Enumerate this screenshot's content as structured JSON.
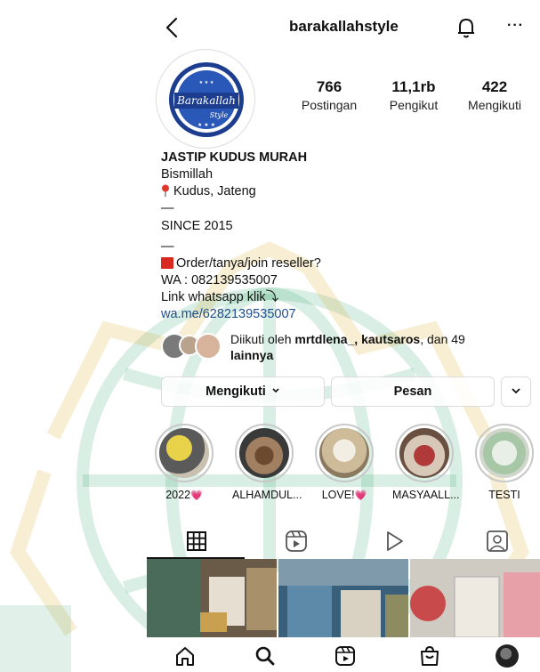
{
  "header": {
    "username": "barakallahstyle",
    "more": "···"
  },
  "profile": {
    "avatar_text": "Barakallah Style",
    "stats": [
      {
        "value": "766",
        "label": "Postingan"
      },
      {
        "value": "11,1rb",
        "label": "Pengikut"
      },
      {
        "value": "422",
        "label": "Mengikuti"
      }
    ]
  },
  "bio": {
    "name": "JASTIP KUDUS MURAH",
    "line1": "Bismillah",
    "location": "Kudus, Jateng",
    "dash1": "—",
    "since": "SINCE 2015",
    "dash2": "—",
    "order": "Order/tanya/join reseller?",
    "wa": "WA : 082139535007",
    "link_label": "Link whatsapp klik⤵",
    "link": "wa.me/6282139535007"
  },
  "followed_by": {
    "prefix": "Diikuti oleh ",
    "names": "mrtdlena_, kautsaros",
    "suffix": ", dan 49",
    "more": "lainnya"
  },
  "actions": {
    "follow": "Mengikuti",
    "message": "Pesan"
  },
  "highlights": [
    {
      "label": "2022",
      "heart": "💗",
      "color": "#c9a740"
    },
    {
      "label": "ALHAMDUL...",
      "heart": "",
      "color": "#8a6a4a"
    },
    {
      "label": "LOVE!",
      "heart": "💗",
      "color": "#d9c8b0"
    },
    {
      "label": "MASYAALL...",
      "heart": "",
      "color": "#a84a4a"
    },
    {
      "label": "TESTI",
      "heart": "",
      "color": "#9fbfa0"
    }
  ],
  "icons": {
    "back": "back-arrow-icon",
    "bell": "bell-icon",
    "grid": "grid-icon",
    "reels": "reels-icon",
    "video": "play-icon",
    "tagged": "tagged-icon",
    "home": "home-icon",
    "search": "search-icon",
    "reels_nav": "reels-icon",
    "shop": "shop-icon",
    "profile": "profile-icon"
  }
}
